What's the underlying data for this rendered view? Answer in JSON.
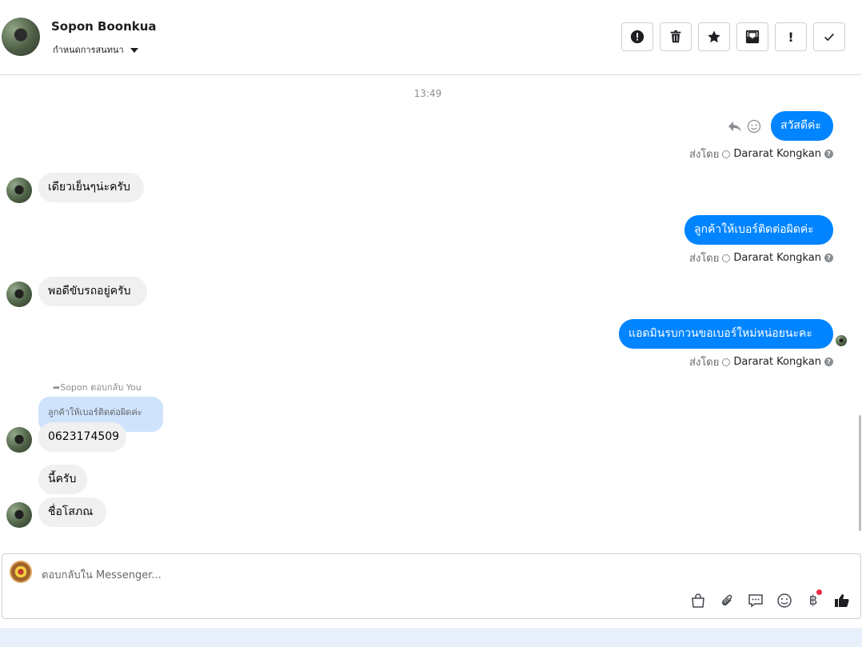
{
  "header": {
    "contact_name": "Sopon Boonkua",
    "assign_label": "กำหนดการสนทนา"
  },
  "actions": [
    {
      "icon": "alert-circle-icon"
    },
    {
      "icon": "trash-icon"
    },
    {
      "icon": "star-icon"
    },
    {
      "icon": "mark-unread-icon"
    },
    {
      "icon": "exclamation-icon",
      "label": "!"
    },
    {
      "icon": "check-icon"
    }
  ],
  "chat": {
    "timestamp": "13:49",
    "sent_by_label": "ส่งโดย",
    "agent_name": "Dararat Kongkan",
    "messages": {
      "m1": "สวัสดีค่ะ",
      "m2": "เดียวเย็นๆน่ะครับ",
      "m3": "ลูกค้าให้เบอร์ติดต่อผิดค่ะ",
      "m4": "พอดีขับรถอยู่ครับ",
      "m5": "แอดมินรบกวนขอเบอร์ใหม่หน่อยนะคะ",
      "m6": "0623174509",
      "m7": "นี้ครับ",
      "m8": "ชื่อโสภณ"
    },
    "reply_note": "Sopon ตอบกลับ You",
    "quoted_text": "ลูกค้าให้เบอร์ติดต่อผิดค่ะ"
  },
  "composer": {
    "placeholder": "ตอบกลับใน Messenger...",
    "baht_symbol": "฿"
  },
  "colors": {
    "outgoing_bubble": "#0084ff",
    "incoming_bubble": "#f0f0f0",
    "quoted_bubble": "#cfe3fd"
  }
}
